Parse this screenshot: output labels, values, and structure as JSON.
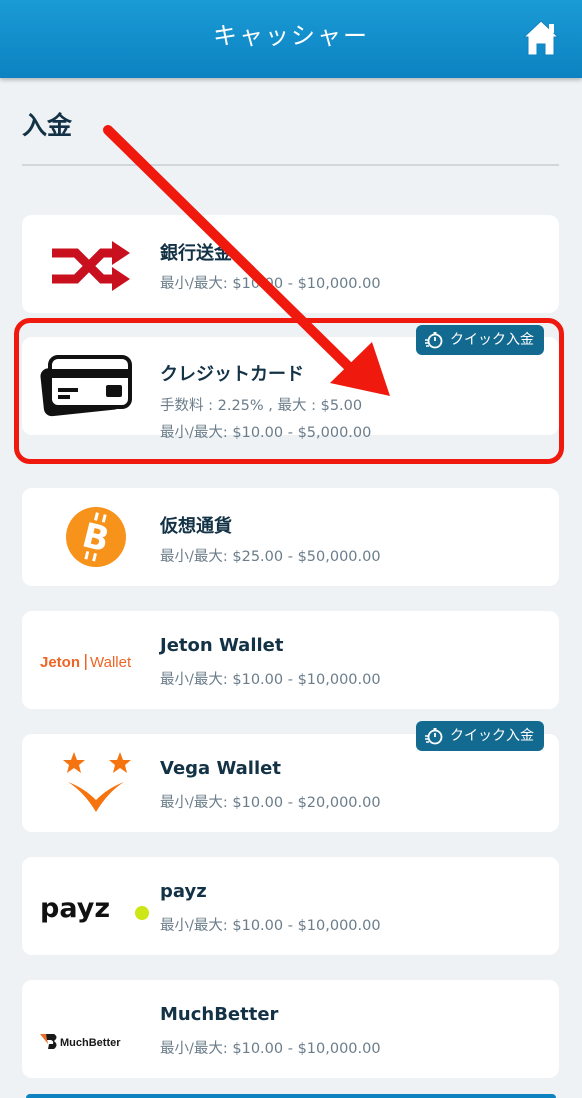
{
  "header": {
    "title": "キャッシャー"
  },
  "section": {
    "title": "入金"
  },
  "quick_label": "クイック入金",
  "colors": {
    "header": "#0c82c1",
    "highlight": "#f0190d",
    "badge": "#136a90"
  },
  "methods": [
    {
      "name": "銀行送金",
      "limits": "最小/最大: $10.00 - $10,000.00",
      "icon": "shuffle-icon"
    },
    {
      "name": "クレジットカード",
      "fee": "手数料 : 2.25% , 最大 : $5.00",
      "limits": "最小/最大: $10.00 - $5,000.00",
      "icon": "credit-card-icon",
      "quick": true,
      "highlighted": true
    },
    {
      "name": "仮想通貨",
      "limits": "最小/最大: $25.00 - $50,000.00",
      "icon": "bitcoin-icon"
    },
    {
      "name": "Jeton Wallet",
      "limits": "最小/最大: $10.00 - $10,000.00",
      "icon": "jeton-wallet-logo",
      "logo_text": [
        "Jeton",
        "Wallet"
      ]
    },
    {
      "name": "Vega Wallet",
      "limits": "最小/最大: $10.00 - $20,000.00",
      "icon": "vega-wallet-logo",
      "quick": true
    },
    {
      "name": "payz",
      "limits": "最小/最大: $10.00 - $10,000.00",
      "icon": "payz-logo",
      "logo_text": "payz"
    },
    {
      "name": "MuchBetter",
      "limits": "最小/最大: $10.00 - $10,000.00",
      "icon": "muchbetter-logo",
      "logo_text": "MuchBetter"
    }
  ]
}
